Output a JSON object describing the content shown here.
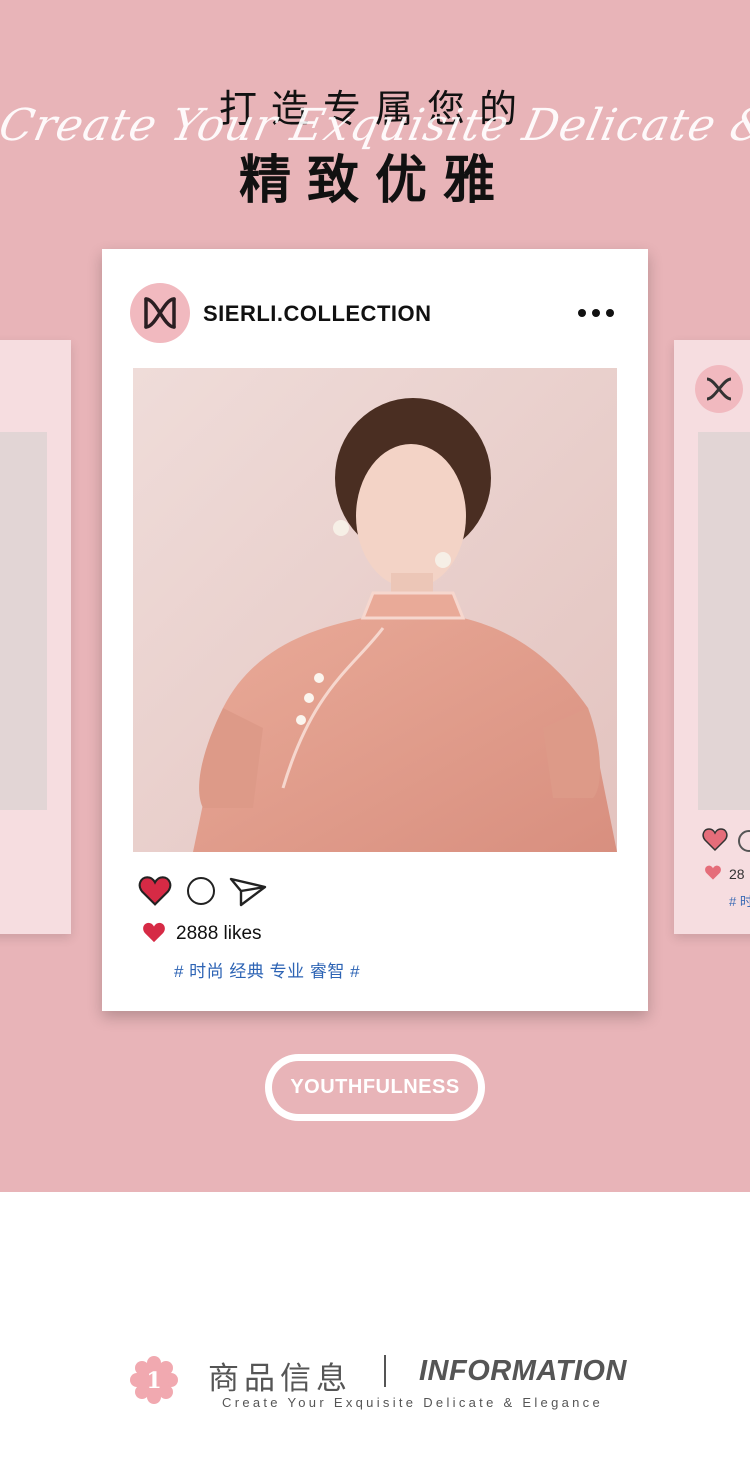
{
  "header": {
    "title_top": "打造专属您的",
    "script_text": "Create Your Exquisite Delicate & Elegance",
    "title_main": "精致优雅"
  },
  "post": {
    "username": "SIERLI.COLLECTION",
    "likes": "2888 likes",
    "hashtags": "# 时尚 经典 专业 睿智 #"
  },
  "side_card_right": {
    "likes_partial": "28",
    "hashtag_partial": "# 时"
  },
  "badge_button": {
    "label": "YOUTHFULNESS"
  },
  "info": {
    "badge_number": "1",
    "title_cn": "商品信息",
    "title_en": "INFORMATION",
    "subtitle": "Create Your Exquisite Delicate & Elegance"
  },
  "colors": {
    "hero_bg": "#e8b4b8",
    "heart": "#d62a45",
    "hashtag": "#2c63b4",
    "badge_flower": "#f1a9b0"
  },
  "icons": [
    "logo-icon",
    "more-icon",
    "heart-icon",
    "comment-icon",
    "send-icon",
    "flower-badge-icon"
  ]
}
